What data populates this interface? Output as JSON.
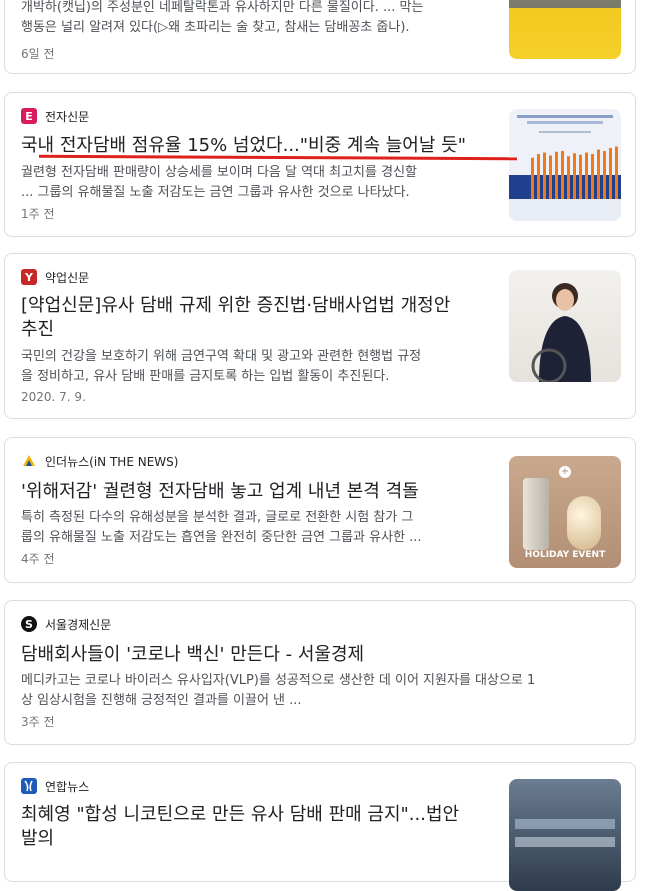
{
  "card0": {
    "snippet_line1": "개박하(캣닙)의 주성분인 네페탈락톤과 유사하지만 다른 물질이다. ... 막는",
    "snippet_line2": "행동은 널리 알려져 있다(▷왜 초파리는 술 찾고, 참새는 담배꽁초 줍나).",
    "date": "6일 전"
  },
  "card1": {
    "source": "전자신문",
    "logo_letter": "E",
    "title": "국내 전자담배 점유율 15% 넘었다...\"비중 계속 늘어날 듯\"",
    "snippet_line1": "궐련형 전자담배 판매량이 상승세를 보이며 다음 달 역대 최고치를 경신할",
    "snippet_line2": "... 그룹의 유해물질 노출 저감도는 금연 그룹과 유사한 것으로 나타났다.",
    "date": "1주 전",
    "chart_values": [
      55,
      60,
      62,
      58,
      63,
      64,
      57,
      61,
      59,
      62,
      60,
      66,
      64,
      68,
      70
    ]
  },
  "card2": {
    "source": "약업신문",
    "logo_letter": "Y",
    "title_line1": "[약업신문]유사 담배 규제 위한 증진법·담배사업법 개정안",
    "title_line2": "추진",
    "snippet_line1": "국민의 건강을 보호하기 위해 금연구역 확대 및 광고와 관련한 현행법 규정",
    "snippet_line2": "을 정비하고, 유사 담배 판매를 금지토록 하는 입법 활동이 추진된다.",
    "date": "2020. 7. 9."
  },
  "card3": {
    "source": "인더뉴스(iN THE NEWS)",
    "title": "'위해저감' 궐련형 전자담배 놓고 업계 내년 본격 격돌",
    "snippet_line1": "특히 측정된 다수의 유해성분을 분석한 결과, 글로로 전환한 시험 참가 그",
    "snippet_line2": "룹의 유해물질 노출 저감도는 흡연을 완전히 중단한 금연 그룹과 유사한 ...",
    "date": "4주 전",
    "thumb_text": "HOLIDAY EVENT"
  },
  "card4": {
    "source": "서울경제신문",
    "logo_letter": "S",
    "title": "담배회사들이 '코로나 백신' 만든다 - 서울경제",
    "snippet_line1": "메디카고는 코로나 바이러스 유사입자(VLP)를 성공적으로 생산한 데 이어 지원자를 대상으로 1",
    "snippet_line2": "상 임상시험을 진행해 긍정적인 결과를 이끌어 낸 ...",
    "date": "3주 전"
  },
  "card5": {
    "source": "연합뉴스",
    "title_line1": "최혜영 \"합성 니코틴으로 만든 유사 담배 판매 금지\"...법안",
    "title_line2": "발의"
  },
  "colors": {
    "title": "#202124",
    "snippet": "#4d5156",
    "accent_red": "#e0201b"
  }
}
